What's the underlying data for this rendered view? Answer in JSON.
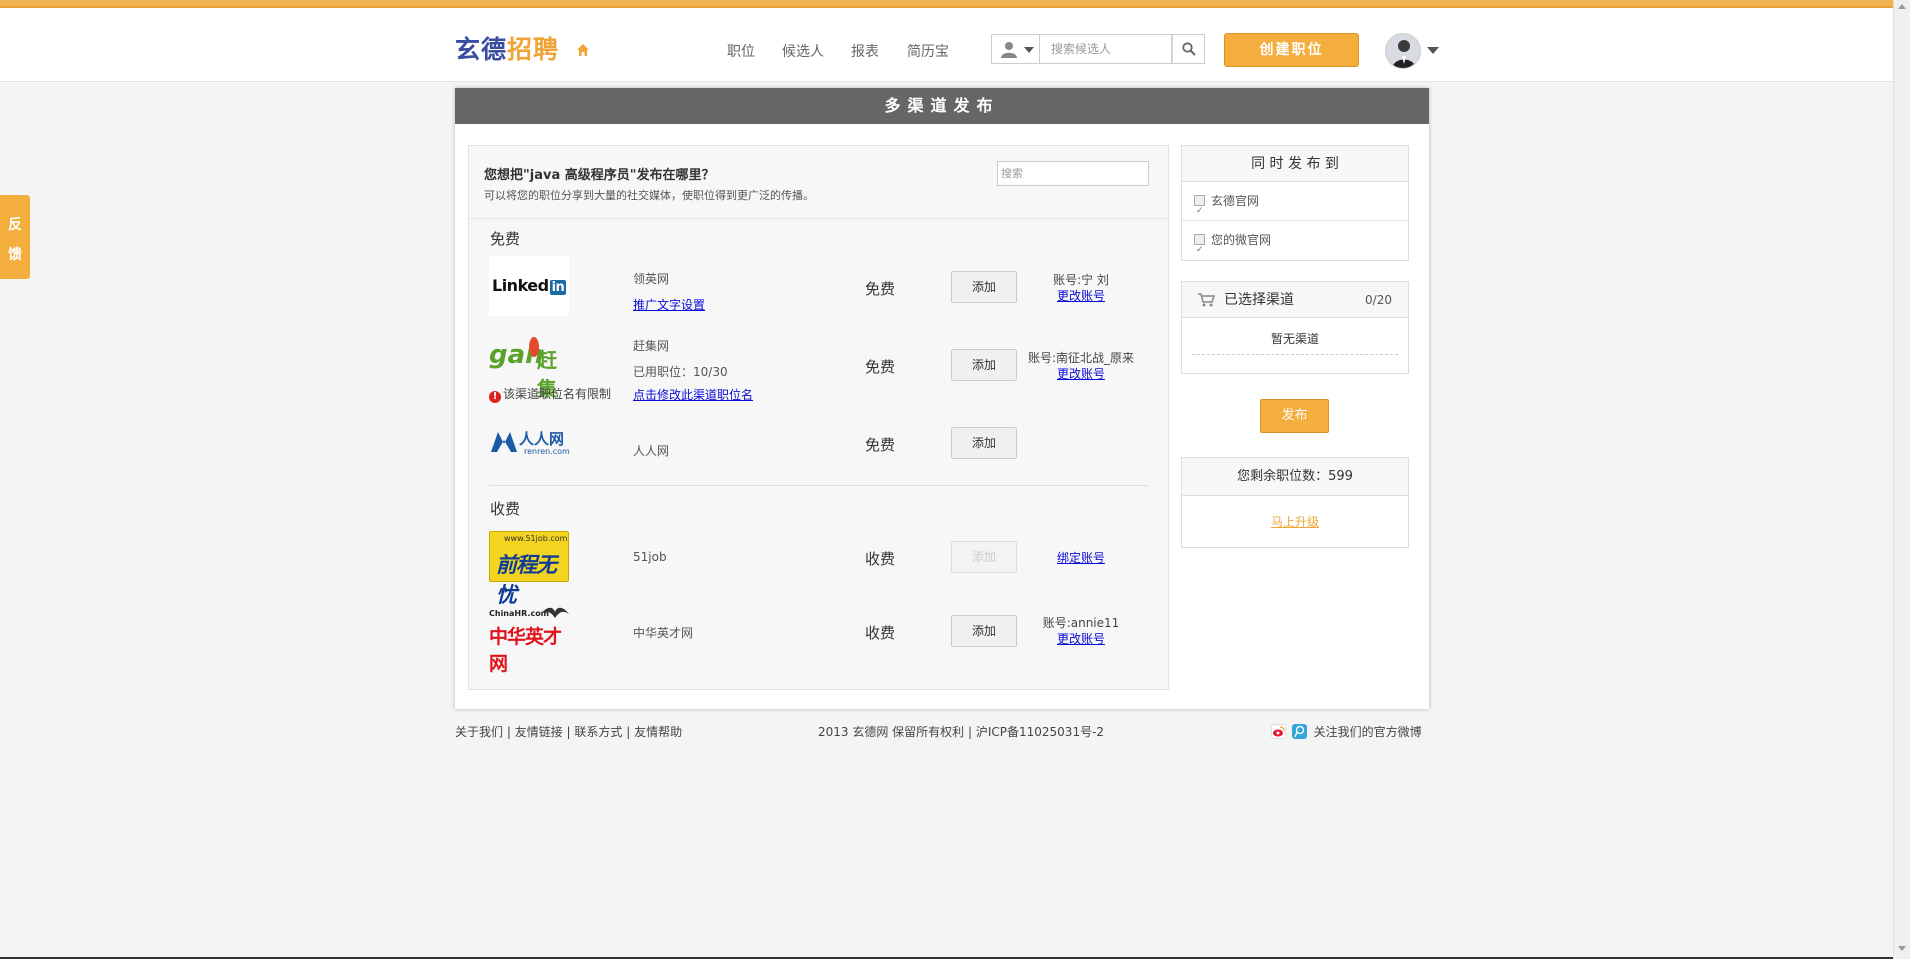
{
  "header": {
    "logo_part1": "玄德",
    "logo_part2": "招聘",
    "nav": [
      "职位",
      "候选人",
      "报表",
      "简历宝"
    ],
    "search_placeholder": "搜索候选人",
    "create_label": "创建职位"
  },
  "feedback": {
    "char1": "反",
    "char2": "馈"
  },
  "panel": {
    "title": "多渠道发布",
    "question": "您想把\"java 高级程序员\"发布在哪里？",
    "subtitle": "可以将您的职位分享到大量的社交媒体，使职位得到更广泛的传播。",
    "search_placeholder": "搜索",
    "free_label": "免费",
    "paid_label": "收费"
  },
  "channels": {
    "linkedin": {
      "logo_text": "Linked",
      "logo_badge": "in",
      "name": "领英网",
      "link": "推广文字设置",
      "price": "免费",
      "add": "添加",
      "account": "账号:宁 刘",
      "account_link": "更改账号"
    },
    "ganji": {
      "logo_text": "gan",
      "logo_cn": "赶集",
      "name": "赶集网",
      "used": "已用职位：10/30",
      "link": "点击修改此渠道职位名",
      "warn": "该渠道职位名有限制",
      "price": "免费",
      "add": "添加",
      "account": "账号:南征北战_原来",
      "account_link": "更改账号"
    },
    "renren": {
      "logo_cn": "人人网",
      "logo_en": "renren.com",
      "name": "人人网",
      "price": "免费",
      "add": "添加"
    },
    "job51": {
      "logo_url": "www.51job.com",
      "logo_cn": "前程无忧",
      "name": "51job",
      "price": "收费",
      "add": "添加",
      "account_link": "绑定账号"
    },
    "chinahr": {
      "logo_en": "ChinaHR.com",
      "logo_cn": "中华英才网",
      "name": "中华英才网",
      "price": "收费",
      "add": "添加",
      "account": "账号:annie11",
      "account_link": "更改账号"
    }
  },
  "sidebar": {
    "also_head": "同 时 发 布 到",
    "also_items": [
      "玄德官网",
      "您的微官网"
    ],
    "selected_head": "已选择渠道",
    "selected_count": "0/20",
    "selected_empty": "暂无渠道",
    "publish_label": "发布",
    "remaining": "您剩余职位数：599",
    "upgrade": "马上升级"
  },
  "footer": {
    "links": [
      "关于我们",
      "友情链接",
      "联系方式",
      "友情帮助"
    ],
    "copyright": "2013 玄德网 保留所有权利 | 沪ICP备11025031号-2",
    "follow": "关注我们的官方微博"
  },
  "colors": {
    "accent": "#f4ae3d",
    "title_bar": "#666666",
    "link": "#0a0ad8"
  }
}
